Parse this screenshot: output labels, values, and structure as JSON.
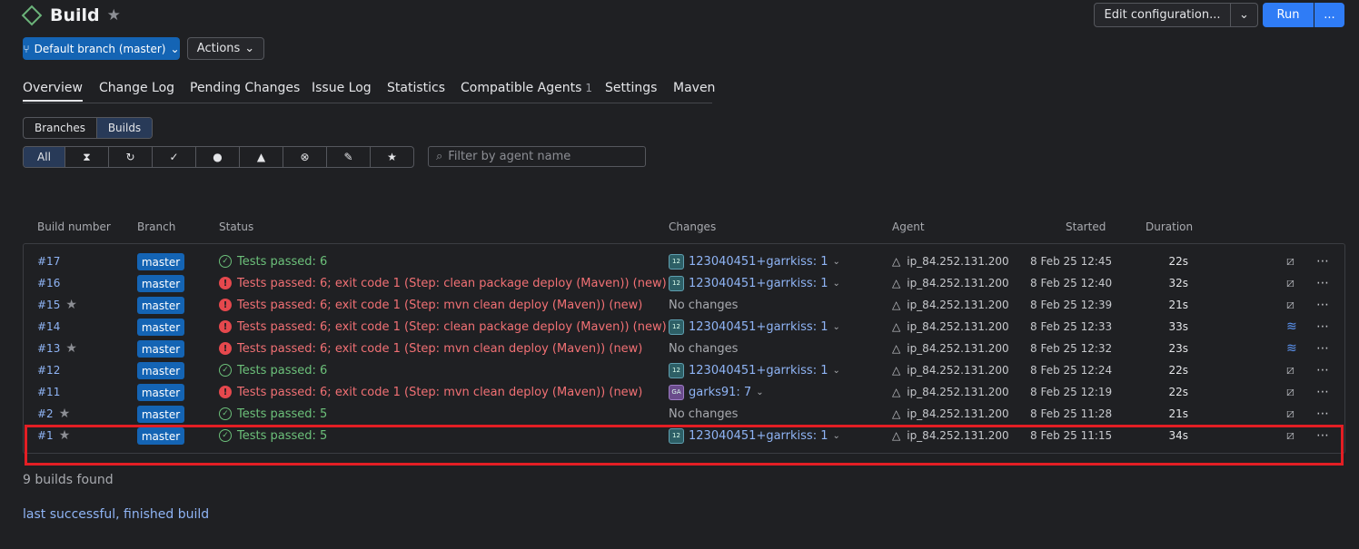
{
  "header": {
    "title": "Build",
    "branch_label": "Default branch (master)",
    "actions_label": "Actions",
    "edit_label": "Edit configuration...",
    "run_label": "Run",
    "more_label": "..."
  },
  "tabs": [
    {
      "label": "Overview",
      "active": true
    },
    {
      "label": "Change Log"
    },
    {
      "label": "Pending Changes"
    },
    {
      "label": "Issue Log"
    },
    {
      "label": "Statistics"
    },
    {
      "label": "Compatible Agents",
      "count": "1"
    },
    {
      "label": "Settings"
    },
    {
      "label": "Maven"
    }
  ],
  "view_toggle": {
    "branches": "Branches",
    "builds": "Builds"
  },
  "filters": {
    "all": "All",
    "icons": [
      "hourglass-icon",
      "running-icon",
      "success-icon",
      "failed-icon",
      "warning-icon",
      "cancelled-icon",
      "pin-icon",
      "star-icon"
    ],
    "search_placeholder": "Filter by agent name"
  },
  "columns": {
    "build_number": "Build number",
    "branch": "Branch",
    "status": "Status",
    "changes": "Changes",
    "agent": "Agent",
    "started": "Started",
    "duration": "Duration"
  },
  "builds": [
    {
      "number": "#17",
      "starred": false,
      "branch": "master",
      "result": "ok",
      "status": "Tests passed: 6",
      "avatar": "12",
      "changes": "123040451+garrkiss: 1",
      "agent": "ip_84.252.131.200",
      "started": "8 Feb 25 12:45",
      "duration": "22s",
      "action_icon": "stack-crossed-icon"
    },
    {
      "number": "#16",
      "starred": false,
      "branch": "master",
      "result": "err",
      "status": "Tests passed: 6; exit code 1 (Step: clean package deploy (Maven)) (new)",
      "avatar": "12",
      "changes": "123040451+garrkiss: 1",
      "agent": "ip_84.252.131.200",
      "started": "8 Feb 25 12:40",
      "duration": "32s",
      "action_icon": "stack-crossed-icon"
    },
    {
      "number": "#15",
      "starred": true,
      "branch": "master",
      "result": "err",
      "status": "Tests passed: 6; exit code 1 (Step: mvn clean deploy (Maven)) (new)",
      "avatar": "",
      "changes": "No changes",
      "agent": "ip_84.252.131.200",
      "started": "8 Feb 25 12:39",
      "duration": "21s",
      "action_icon": "stack-crossed-icon"
    },
    {
      "number": "#14",
      "starred": false,
      "branch": "master",
      "result": "err",
      "status": "Tests passed: 6; exit code 1 (Step: clean package deploy (Maven)) (new)",
      "avatar": "12",
      "changes": "123040451+garrkiss: 1",
      "agent": "ip_84.252.131.200",
      "started": "8 Feb 25 12:33",
      "duration": "33s",
      "action_icon": "stack-icon"
    },
    {
      "number": "#13",
      "starred": true,
      "branch": "master",
      "result": "err",
      "status": "Tests passed: 6; exit code 1 (Step: mvn clean deploy (Maven)) (new)",
      "avatar": "",
      "changes": "No changes",
      "agent": "ip_84.252.131.200",
      "started": "8 Feb 25 12:32",
      "duration": "23s",
      "action_icon": "stack-icon"
    },
    {
      "number": "#12",
      "starred": false,
      "branch": "master",
      "result": "ok",
      "status": "Tests passed: 6",
      "avatar": "12",
      "changes": "123040451+garrkiss: 1",
      "agent": "ip_84.252.131.200",
      "started": "8 Feb 25 12:24",
      "duration": "22s",
      "action_icon": "stack-crossed-icon"
    },
    {
      "number": "#11",
      "starred": false,
      "branch": "master",
      "result": "err",
      "status": "Tests passed: 6; exit code 1 (Step: mvn clean deploy (Maven)) (new)",
      "avatar": "GA",
      "changes": "garks91: 7",
      "agent": "ip_84.252.131.200",
      "started": "8 Feb 25 12:19",
      "duration": "22s",
      "action_icon": "stack-crossed-icon"
    },
    {
      "number": "#2",
      "starred": true,
      "branch": "master",
      "result": "ok",
      "status": "Tests passed: 5",
      "avatar": "",
      "changes": "No changes",
      "agent": "ip_84.252.131.200",
      "started": "8 Feb 25 11:28",
      "duration": "21s",
      "action_icon": "stack-crossed-icon"
    },
    {
      "number": "#1",
      "starred": true,
      "branch": "master",
      "result": "ok",
      "status": "Tests passed: 5",
      "avatar": "12",
      "changes": "123040451+garrkiss: 1",
      "agent": "ip_84.252.131.200",
      "started": "8 Feb 25 11:15",
      "duration": "34s",
      "action_icon": "stack-crossed-icon"
    }
  ],
  "footer": {
    "count": "9 builds found",
    "link": "last successful, finished build"
  },
  "colors": {
    "accent": "#2f7cf6",
    "branch_badge": "#1464b4",
    "success": "#6cc07a",
    "error": "#f17074",
    "highlight": "#e31e24"
  }
}
